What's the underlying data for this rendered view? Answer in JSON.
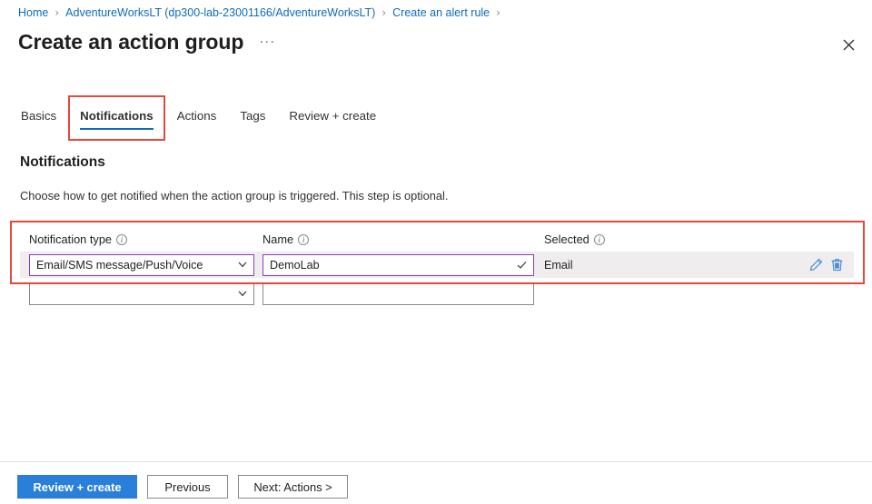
{
  "breadcrumb": {
    "items": [
      {
        "label": "Home"
      },
      {
        "label": "AdventureWorksLT (dp300-lab-23001166/AdventureWorksLT)"
      },
      {
        "label": "Create an alert rule"
      }
    ],
    "separator": "›"
  },
  "header": {
    "title": "Create an action group",
    "more_label": "···",
    "close_label": "✕"
  },
  "tabs": [
    {
      "label": "Basics",
      "active": false
    },
    {
      "label": "Notifications",
      "active": true
    },
    {
      "label": "Actions",
      "active": false
    },
    {
      "label": "Tags",
      "active": false
    },
    {
      "label": "Review + create",
      "active": false
    }
  ],
  "section": {
    "heading": "Notifications",
    "description": "Choose how to get notified when the action group is triggered. This step is optional."
  },
  "grid": {
    "columns": [
      {
        "header": "Notification type",
        "info": "ⓘ"
      },
      {
        "header": "Name",
        "info": "ⓘ"
      },
      {
        "header": "Selected",
        "info": "ⓘ"
      }
    ],
    "info_glyph": "i",
    "rows": [
      {
        "notification_type": "Email/SMS message/Push/Voice",
        "name": "DemoLab",
        "selected": "Email",
        "filled": true,
        "edit_label": "edit",
        "delete_label": "delete"
      },
      {
        "notification_type": "",
        "name": "",
        "selected": "",
        "filled": false
      }
    ]
  },
  "footer": {
    "review_create": "Review + create",
    "previous": "Previous",
    "next": "Next: Actions  >"
  },
  "colors": {
    "accent_blue": "#0f6cbd",
    "primary_button": "#2a7fda",
    "highlight_red": "#e8483a",
    "field_purple": "#8f3bb5",
    "row_background": "#efedee",
    "icon_blue": "#4b90d6"
  }
}
